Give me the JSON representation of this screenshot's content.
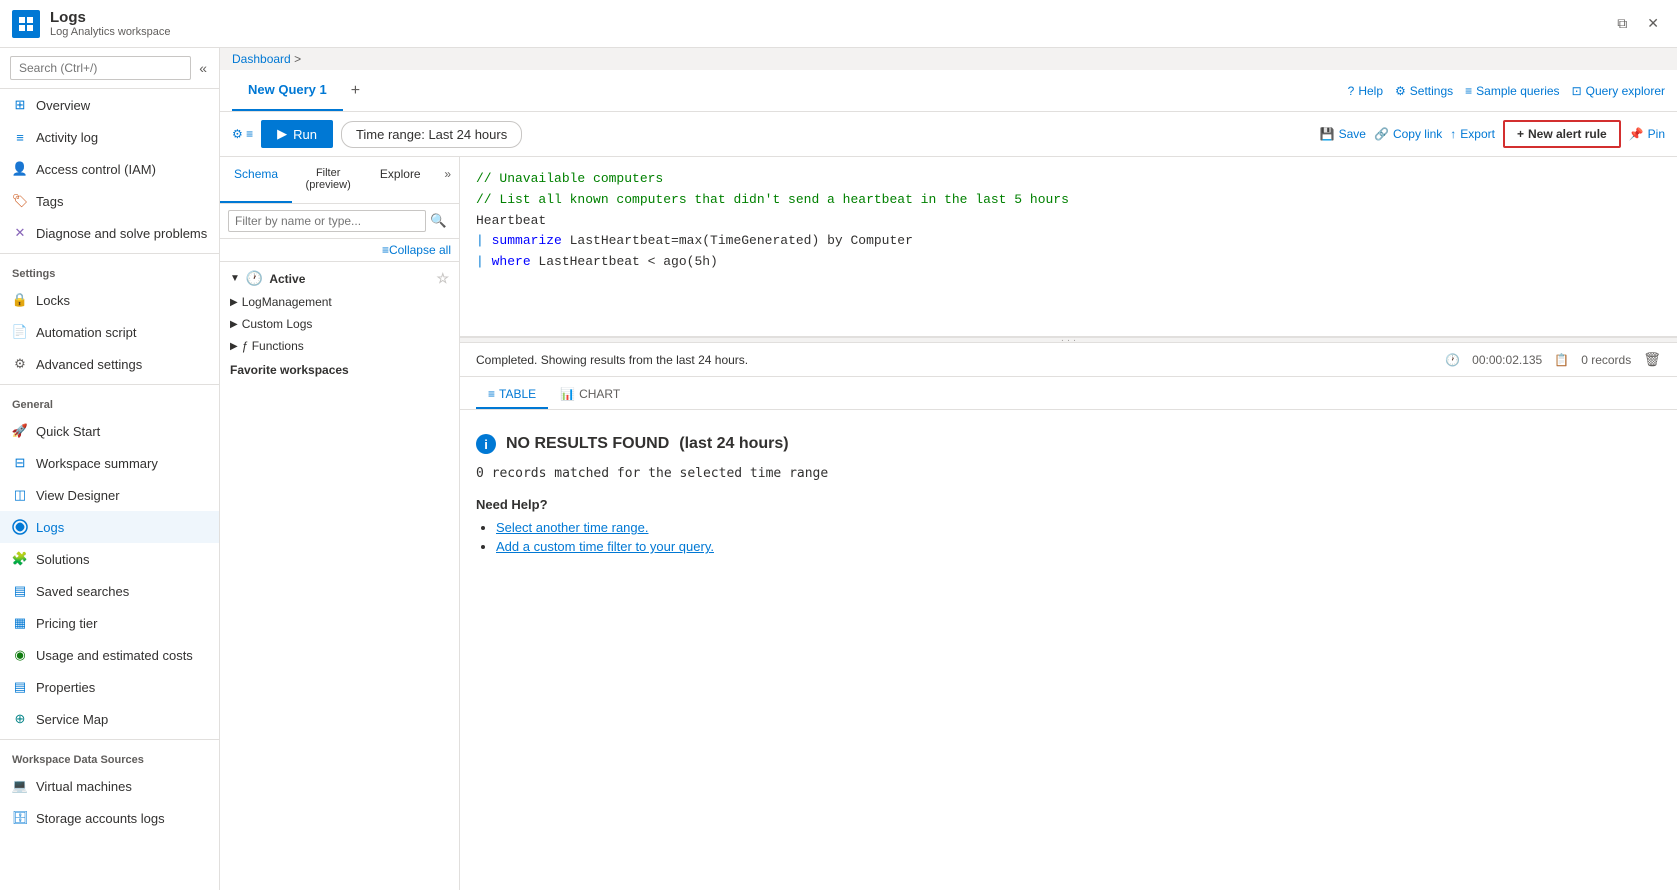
{
  "titleBar": {
    "appName": "Logs",
    "appSub": "Log Analytics workspace",
    "minimizeBtn": "─",
    "maximizeBtn": "□",
    "closeBtn": "✕",
    "restoreBtn": "⧉"
  },
  "breadcrumb": {
    "items": [
      "Dashboard",
      ">"
    ]
  },
  "sidebar": {
    "searchPlaceholder": "Search (Ctrl+/)",
    "items": [
      {
        "id": "overview",
        "label": "Overview",
        "iconType": "grid"
      },
      {
        "id": "activity-log",
        "label": "Activity log",
        "iconType": "list"
      },
      {
        "id": "access-control",
        "label": "Access control (IAM)",
        "iconType": "person"
      },
      {
        "id": "tags",
        "label": "Tags",
        "iconType": "tag"
      },
      {
        "id": "diagnose",
        "label": "Diagnose and solve problems",
        "iconType": "wrench"
      }
    ],
    "settingsLabel": "Settings",
    "settingsItems": [
      {
        "id": "locks",
        "label": "Locks",
        "iconType": "lock"
      },
      {
        "id": "automation",
        "label": "Automation script",
        "iconType": "script"
      },
      {
        "id": "advanced",
        "label": "Advanced settings",
        "iconType": "settings"
      }
    ],
    "generalLabel": "General",
    "generalItems": [
      {
        "id": "quickstart",
        "label": "Quick Start",
        "iconType": "rocket"
      },
      {
        "id": "workspace-summary",
        "label": "Workspace summary",
        "iconType": "grid2"
      },
      {
        "id": "view-designer",
        "label": "View Designer",
        "iconType": "view"
      },
      {
        "id": "logs",
        "label": "Logs",
        "iconType": "logs",
        "active": true
      },
      {
        "id": "solutions",
        "label": "Solutions",
        "iconType": "puzzle"
      },
      {
        "id": "saved-searches",
        "label": "Saved searches",
        "iconType": "bars"
      },
      {
        "id": "pricing",
        "label": "Pricing tier",
        "iconType": "pricing"
      },
      {
        "id": "usage",
        "label": "Usage and estimated costs",
        "iconType": "usage"
      },
      {
        "id": "properties",
        "label": "Properties",
        "iconType": "props"
      },
      {
        "id": "service-map",
        "label": "Service Map",
        "iconType": "map"
      }
    ],
    "workspaceLabel": "Workspace Data Sources",
    "workspaceItems": [
      {
        "id": "virtual-machines",
        "label": "Virtual machines",
        "iconType": "vm"
      },
      {
        "id": "storage-logs",
        "label": "Storage accounts logs",
        "iconType": "storage"
      }
    ]
  },
  "tabs": {
    "items": [
      {
        "id": "new-query-1",
        "label": "New Query 1",
        "active": true
      }
    ],
    "addBtn": "+",
    "rightItems": [
      {
        "id": "help",
        "label": "Help",
        "iconType": "help"
      },
      {
        "id": "settings",
        "label": "Settings",
        "iconType": "gear"
      },
      {
        "id": "sample-queries",
        "label": "Sample queries",
        "iconType": "list"
      },
      {
        "id": "query-explorer",
        "label": "Query explorer",
        "iconType": "explorer"
      }
    ]
  },
  "toolbar": {
    "settingsIcon": "≡",
    "runBtn": "▶ Run",
    "timeRange": "Time range: Last 24 hours",
    "saveBtn": "Save",
    "copyLinkBtn": "Copy link",
    "exportBtn": "Export",
    "newAlertBtn": "+ New alert rule",
    "pinBtn": "Pin"
  },
  "schemaPanel": {
    "tabs": [
      "Schema",
      "Filter (preview)",
      "Explore"
    ],
    "activeTab": "Schema",
    "searchPlaceholder": "Filter by name or type...",
    "collapseAll": "Collapse all",
    "activeSectionLabel": "Active",
    "groups": [
      {
        "id": "log-management",
        "label": "LogManagement"
      },
      {
        "id": "custom-logs",
        "label": "Custom Logs"
      },
      {
        "id": "functions",
        "label": "ƒ  Functions"
      }
    ],
    "favoriteSectionLabel": "Favorite workspaces"
  },
  "editor": {
    "lines": [
      {
        "type": "comment",
        "text": "// Unavailable computers"
      },
      {
        "type": "comment",
        "text": "// List all known computers that didn't send a heartbeat in the last 5 hours"
      },
      {
        "type": "default",
        "text": "Heartbeat"
      },
      {
        "type": "pipe",
        "text": "| summarize LastHeartbeat=max(TimeGenerated) by Computer"
      },
      {
        "type": "pipe",
        "text": "| where LastHeartbeat < ago(5h)"
      }
    ]
  },
  "results": {
    "statusText": "Completed. Showing results from the last 24 hours.",
    "timeTaken": "00:00:02.135",
    "recordCount": "0 records",
    "tabs": [
      "TABLE",
      "CHART"
    ],
    "activeTab": "TABLE",
    "noResultsTitle": "NO RESULTS FOUND",
    "noResultsTimeRange": "(last 24 hours)",
    "noResultsSub": "0 records matched for the selected time range",
    "needHelp": "Need Help?",
    "helpLinks": [
      {
        "id": "select-time",
        "text": "Select another time range."
      },
      {
        "id": "add-filter",
        "text": "Add a custom time filter to your query."
      }
    ]
  }
}
